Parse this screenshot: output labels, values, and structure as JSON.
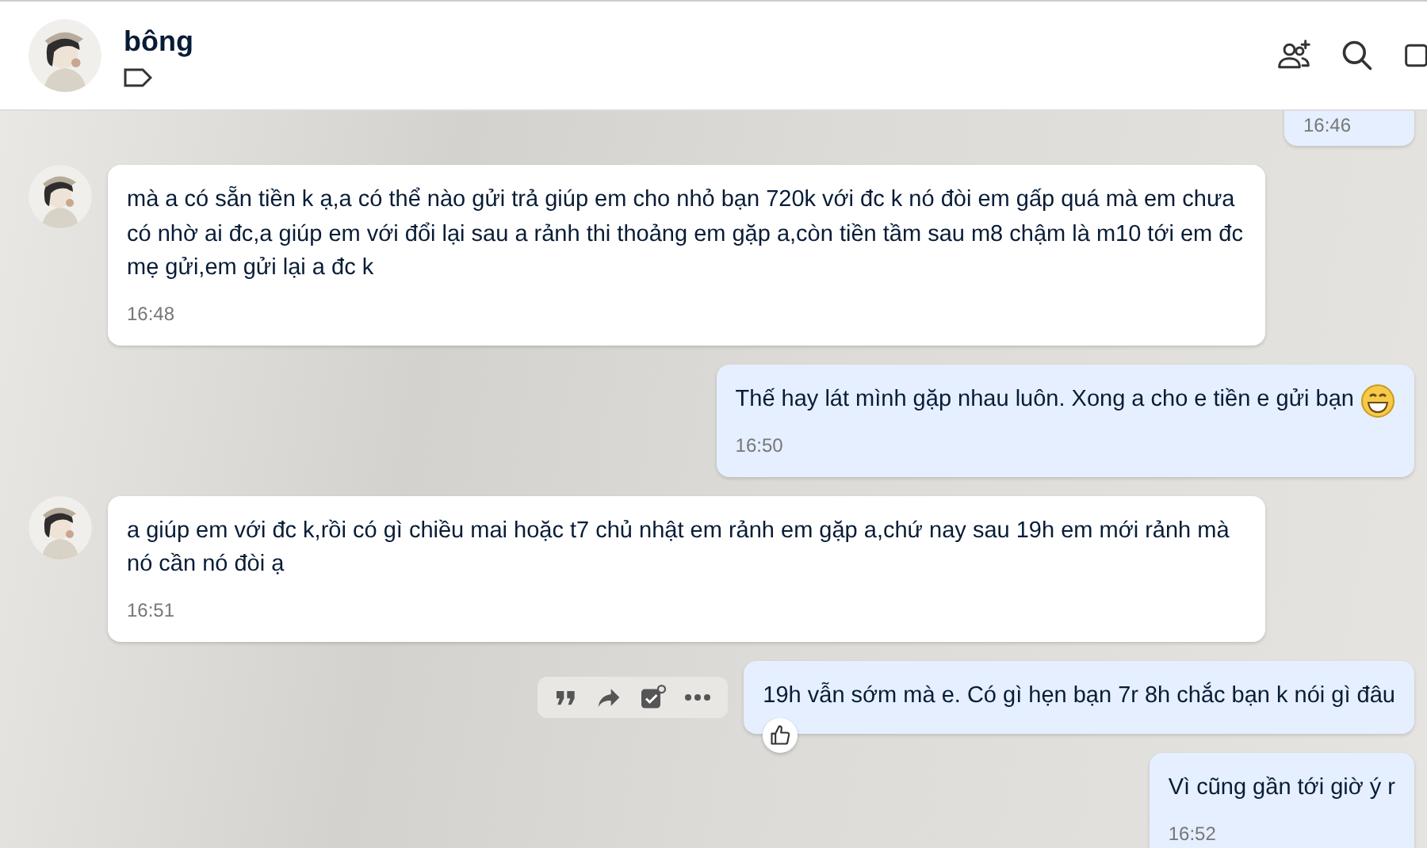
{
  "header": {
    "name": "bông",
    "tag_icon": true
  },
  "messages": [
    {
      "kind": "out",
      "cut_top": true,
      "time": "16:46"
    },
    {
      "kind": "in",
      "avatar": true,
      "text": "mà a có sẵn tiền k ạ,a có thể nào gửi trả giúp em cho nhỏ bạn 720k với đc k nó đòi em gấp quá mà em chưa có nhờ ai đc,a giúp em với đổi lại sau a rảnh thi thoảng em gặp a,còn tiền tầm sau m8 chậm là m10 tới em đc mẹ gửi,em gửi lại a đc k",
      "time": "16:48"
    },
    {
      "kind": "out",
      "text": "Thế hay lát mình gặp nhau luôn. Xong a cho e tiền e gửi bạn",
      "emoji": true,
      "time": "16:50"
    },
    {
      "kind": "in",
      "avatar": true,
      "text": "a giúp em với đc k,rồi có gì chiều mai hoặc t7 chủ nhật em rảnh em gặp a,chứ nay sau 19h em mới rảnh mà nó cần nó đòi ạ",
      "time": "16:51"
    },
    {
      "kind": "out",
      "text": "19h vẫn sớm mà e. Có gì hẹn bạn 7r 8h chắc bạn k nói gì đâu",
      "toolbar": true,
      "liked": true
    },
    {
      "kind": "out",
      "text": "Vì cũng gần tới giờ ý r",
      "time": "16:52"
    }
  ]
}
